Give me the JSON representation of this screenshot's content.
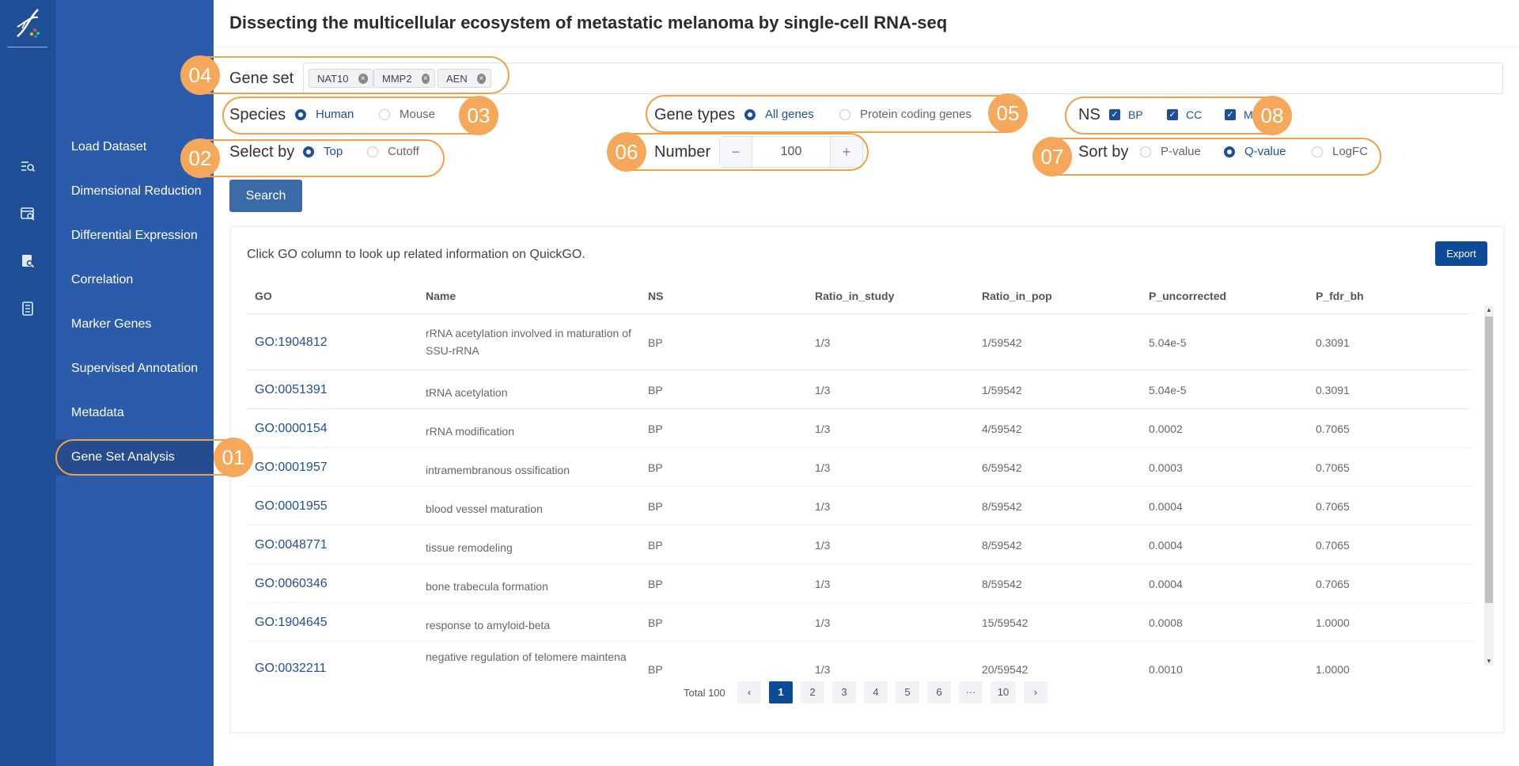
{
  "page_title": "Dissecting the multicellular ecosystem of metastatic melanoma by single-cell RNA-seq",
  "rail_icons": [
    "list-search-icon",
    "window-search-icon",
    "document-search-icon",
    "book-icon"
  ],
  "nav": {
    "items": [
      "Load Dataset",
      "Dimensional Reduction",
      "Differential Expression",
      "Correlation",
      "Marker Genes",
      "Supervised Annotation",
      "Metadata",
      "Gene Set Analysis"
    ],
    "active": "Gene Set Analysis"
  },
  "form": {
    "gene_set_label": "Gene set",
    "genes": [
      "NAT10",
      "MMP2",
      "AEN"
    ],
    "species_label": "Species",
    "species_options": [
      "Human",
      "Mouse"
    ],
    "species_selected": "Human",
    "gene_types_label": "Gene types",
    "gene_types_options": [
      "All genes",
      "Protein coding genes"
    ],
    "gene_types_selected": "All genes",
    "ns_label": "NS",
    "ns_options": [
      "BP",
      "CC",
      "MF"
    ],
    "select_by_label": "Select by",
    "select_by_options": [
      "Top",
      "Cutoff"
    ],
    "select_by_selected": "Top",
    "number_label": "Number",
    "number_value": "100",
    "minus": "−",
    "plus": "+",
    "sort_by_label": "Sort by",
    "sort_by_options": [
      "P-value",
      "Q-value",
      "LogFC"
    ],
    "sort_by_selected": "Q-value",
    "search_label": "Search"
  },
  "results": {
    "hint": "Click GO column to look up related information on QuickGO.",
    "export_label": "Export",
    "columns": [
      "GO",
      "Name",
      "NS",
      "Ratio_in_study",
      "Ratio_in_pop",
      "P_uncorrected",
      "P_fdr_bh"
    ],
    "rows": [
      [
        "GO:1904812",
        "rRNA acetylation involved in maturation of SSU-rRNA",
        "BP",
        "1/3",
        "1/59542",
        "5.04e-5",
        "0.3091"
      ],
      [
        "GO:0051391",
        "tRNA acetylation",
        "BP",
        "1/3",
        "1/59542",
        "5.04e-5",
        "0.3091"
      ],
      [
        "GO:0000154",
        "rRNA modification",
        "BP",
        "1/3",
        "4/59542",
        "0.0002",
        "0.7065"
      ],
      [
        "GO:0001957",
        "intramembranous ossification",
        "BP",
        "1/3",
        "6/59542",
        "0.0003",
        "0.7065"
      ],
      [
        "GO:0001955",
        "blood vessel maturation",
        "BP",
        "1/3",
        "8/59542",
        "0.0004",
        "0.7065"
      ],
      [
        "GO:0048771",
        "tissue remodeling",
        "BP",
        "1/3",
        "8/59542",
        "0.0004",
        "0.7065"
      ],
      [
        "GO:0060346",
        "bone trabecula formation",
        "BP",
        "1/3",
        "8/59542",
        "0.0004",
        "0.7065"
      ],
      [
        "GO:1904645",
        "response to amyloid-beta",
        "BP",
        "1/3",
        "15/59542",
        "0.0008",
        "1.0000"
      ],
      [
        "GO:0032211",
        "negative regulation of telomere maintena",
        "BP",
        "1/3",
        "20/59542",
        "0.0010",
        "1.0000"
      ]
    ]
  },
  "pagination": {
    "total": "Total 100",
    "pages": [
      "1",
      "2",
      "3",
      "4",
      "5",
      "6",
      "···",
      "10"
    ],
    "current": "1",
    "prev": "‹",
    "next": "›"
  },
  "annotations": [
    "01",
    "02",
    "03",
    "04",
    "05",
    "06",
    "07",
    "08"
  ],
  "colors": {
    "rail": "#1f4f96",
    "nav": "#2b5cab",
    "accent": "#0d4a98",
    "annotation": "#f5a75a"
  }
}
